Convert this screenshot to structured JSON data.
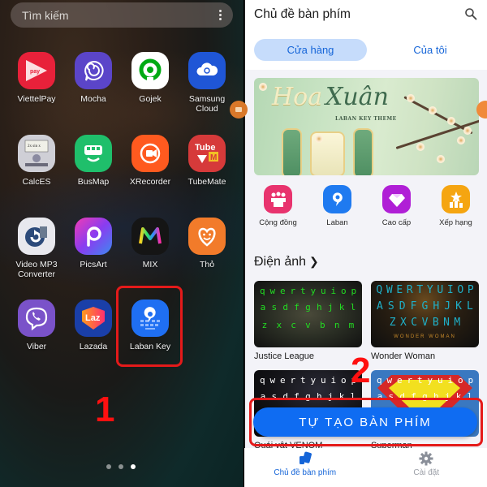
{
  "home": {
    "search_placeholder": "Tìm kiếm",
    "apps": [
      {
        "label": "ViettelPay",
        "icon": "viettelpay-icon",
        "color": "#e8213a"
      },
      {
        "label": "Mocha",
        "icon": "mocha-icon",
        "color": "#5b45c9"
      },
      {
        "label": "Gojek",
        "icon": "gojek-icon",
        "color": "#00aa13"
      },
      {
        "label": "Samsung Cloud",
        "icon": "samsung-cloud-icon",
        "color": "#1f56d6"
      },
      {
        "label": "CalcES",
        "icon": "calculator-icon",
        "color": "#cfcfd6"
      },
      {
        "label": "BusMap",
        "icon": "bus-icon",
        "color": "#1fbf6b"
      },
      {
        "label": "XRecorder",
        "icon": "screen-recorder-icon",
        "color": "#ff5a1f"
      },
      {
        "label": "TubeMate",
        "icon": "tubemate-icon",
        "color": "#d63a3a"
      },
      {
        "label": "Video MP3 Converter",
        "icon": "video-converter-icon",
        "color": "#e8e8ee"
      },
      {
        "label": "PicsArt",
        "icon": "picsart-icon",
        "color": "#b43cf0"
      },
      {
        "label": "MIX",
        "icon": "mix-icon",
        "color": "#151515"
      },
      {
        "label": "Thỏ",
        "icon": "heart-smile-icon",
        "color": "#f27b2a"
      },
      {
        "label": "Viber",
        "icon": "viber-icon",
        "color": "#7a52c9"
      },
      {
        "label": "Lazada",
        "icon": "lazada-icon",
        "color": "#1a3fa8"
      },
      {
        "label": "Laban Key",
        "icon": "laban-key-icon",
        "color": "#1f6ff2"
      }
    ],
    "step_label": "1",
    "page_count": 3,
    "active_page": 3
  },
  "store": {
    "title": "Chủ đề bàn phím",
    "tabs": [
      {
        "label": "Cửa hàng",
        "active": true
      },
      {
        "label": "Của tôi",
        "active": false
      }
    ],
    "banner": {
      "title_part1": "Hoa",
      "title_part2": "Xuân",
      "subtitle": "LABAN KEY THEME"
    },
    "categories": [
      {
        "label": "Cộng đồng",
        "icon": "community-icon",
        "color": "#e8336e"
      },
      {
        "label": "Laban",
        "icon": "laban-icon",
        "color": "#1f7af0"
      },
      {
        "label": "Cao cấp",
        "icon": "diamond-icon",
        "color": "#b01fd6"
      },
      {
        "label": "Xếp hạng",
        "icon": "ranking-icon",
        "color": "#f5a511"
      }
    ],
    "section_title": "Điện ảnh",
    "themes": [
      {
        "label": "Justice League",
        "keys": [
          "qwertyuiop",
          "asdfghjkl",
          "zxcvbnm"
        ]
      },
      {
        "label": "Wonder Woman",
        "keys": [
          "QWERTYUIOP",
          "ASDFGHJKL",
          "ZXCVBNM"
        ],
        "caption": "WONDER WOMAN"
      },
      {
        "label": "Quái vật VENOM",
        "keys": [
          "qwertyuiop",
          "asdfghjkl"
        ]
      },
      {
        "label": "Superman",
        "keys": [
          "qwertyuiop",
          "asdfghjkl"
        ]
      }
    ],
    "cta_label": "TỰ TẠO BÀN PHÍM",
    "step_label": "2",
    "nav": [
      {
        "label": "Chủ đề bàn phím",
        "icon": "themes-icon",
        "active": true
      },
      {
        "label": "Cài đặt",
        "icon": "gear-icon",
        "active": false
      }
    ],
    "accent_color": "#0f6cf2"
  }
}
